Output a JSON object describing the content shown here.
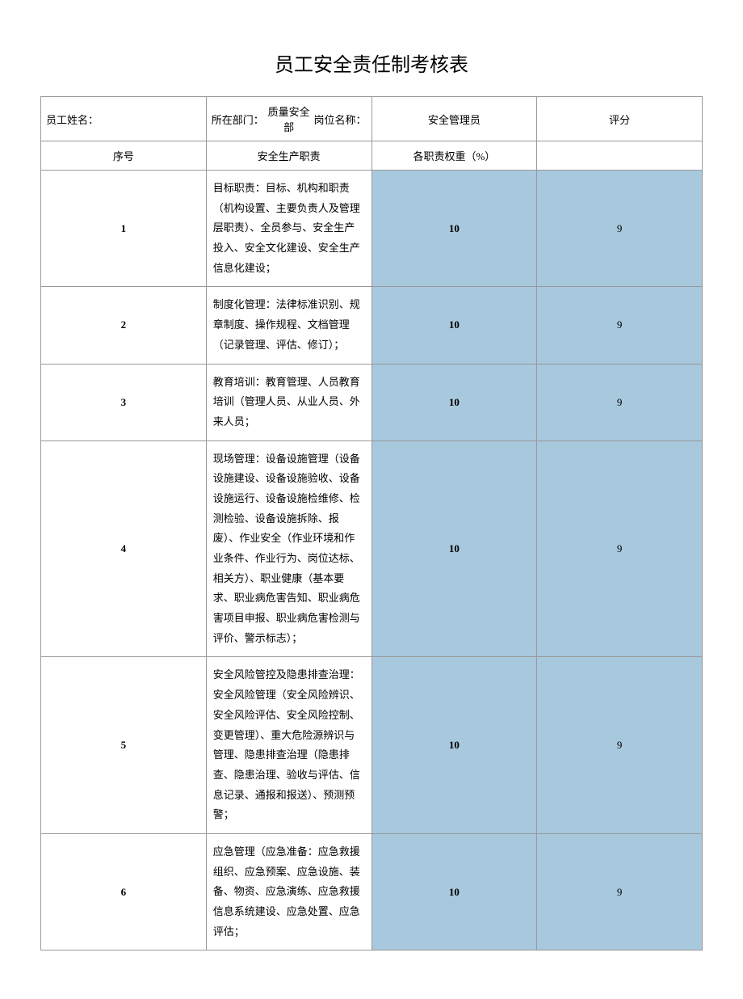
{
  "title": "员工安全责任制考核表",
  "header": {
    "name_label": "员工姓名：",
    "name_value": "",
    "dept_label": "所在部门：",
    "dept_value": "质量安全部",
    "position_label": "岗位名称：",
    "position_value": "安全管理员",
    "score_label": "评分"
  },
  "subheader": {
    "seq": "序号",
    "duty": "安全生产职责",
    "weight": "各职责权重（%）",
    "score": ""
  },
  "rows": [
    {
      "seq": "1",
      "duty": "目标职责：目标、机构和职责（机构设置、主要负责人及管理层职责）、全员参与、安全生产投入、安全文化建设、安全生产信息化建设；",
      "weight": "10",
      "score": "9"
    },
    {
      "seq": "2",
      "duty": "制度化管理：法律标准识别、规章制度、操作规程、文档管理（记录管理、评估、修订）；",
      "weight": "10",
      "score": "9"
    },
    {
      "seq": "3",
      "duty": "教育培训：教育管理、人员教育培训（管理人员、从业人员、外来人员；",
      "weight": "10",
      "score": "9"
    },
    {
      "seq": "4",
      "duty": "现场管理：设备设施管理（设备设施建设、设备设施验收、设备设施运行、设备设施检维修、检测检验、设备设施拆除、报废）、作业安全（作业环境和作业条件、作业行为、岗位达标、相关方）、职业健康（基本要求、职业病危害告知、职业病危害项目申报、职业病危害检测与评价、警示标志）；",
      "weight": "10",
      "score": "9"
    },
    {
      "seq": "5",
      "duty": "安全风险管控及隐患排查治理：安全风险管理（安全风险辨识、安全风险评估、安全风险控制、变更管理）、重大危险源辨识与管理、隐患排查治理（隐患排查、隐患治理、验收与评估、信息记录、通报和报送）、预测预警；",
      "weight": "10",
      "score": "9"
    },
    {
      "seq": "6",
      "duty": "应急管理（应急准备：应急救援组织、应急预案、应急设施、装备、物资、应急演练、应急救援信息系统建设、应急处置、应急评估；",
      "weight": "10",
      "score": "9"
    }
  ]
}
